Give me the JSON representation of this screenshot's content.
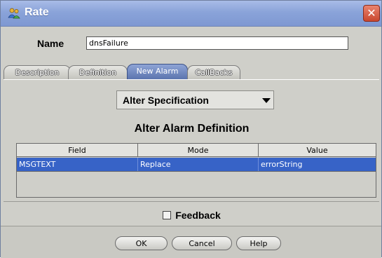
{
  "window": {
    "title": "Rate",
    "app_icon": "people-icon",
    "close_label": "✕"
  },
  "name_field": {
    "label": "Name",
    "value": "dnsFailure"
  },
  "tabs": [
    {
      "label": "Description",
      "active": false
    },
    {
      "label": "Definition",
      "active": false
    },
    {
      "label": "New Alarm",
      "active": true
    },
    {
      "label": "CallBacks",
      "active": false
    }
  ],
  "alter_select": {
    "selected": "Alter Specification"
  },
  "section_title": "Alter Alarm Definition",
  "table": {
    "columns": [
      "Field",
      "Mode",
      "Value"
    ],
    "rows": [
      {
        "field": "MSGTEXT",
        "mode": "Replace",
        "value": "errorString",
        "selected": true
      }
    ]
  },
  "feedback": {
    "label": "Feedback",
    "checked": false
  },
  "buttons": {
    "ok": "OK",
    "cancel": "Cancel",
    "help": "Help"
  },
  "colors": {
    "title_bar": "#8aa3d9",
    "selection": "#3763c7",
    "close_button": "#c9472f"
  }
}
